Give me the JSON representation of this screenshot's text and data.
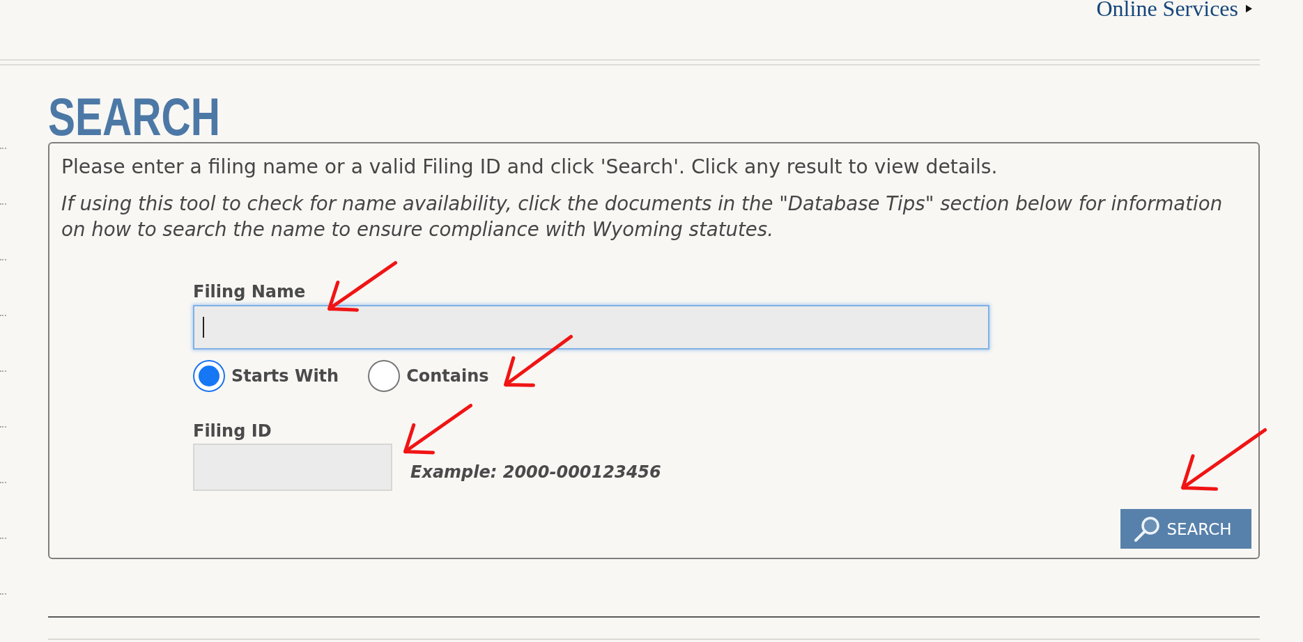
{
  "header": {
    "link": "Online Services"
  },
  "heading": "SEARCH",
  "panel": {
    "instructions": "Please enter a filing name or a valid Filing ID and click 'Search'. Click any result to view details.",
    "note": "If using this tool to check for name availability, click the documents in the \"Database Tips\" section below for information on how to search the name to ensure compliance with Wyoming statutes."
  },
  "form": {
    "filing_name": {
      "label": "Filing Name",
      "focused": true
    },
    "match_options": [
      {
        "label": "Starts With",
        "selected": true
      },
      {
        "label": "Contains",
        "selected": false
      }
    ],
    "filing_id": {
      "label": "Filing ID",
      "hint": "Example: 2000-000123456"
    },
    "search_button": {
      "label": "SEARCH"
    }
  }
}
